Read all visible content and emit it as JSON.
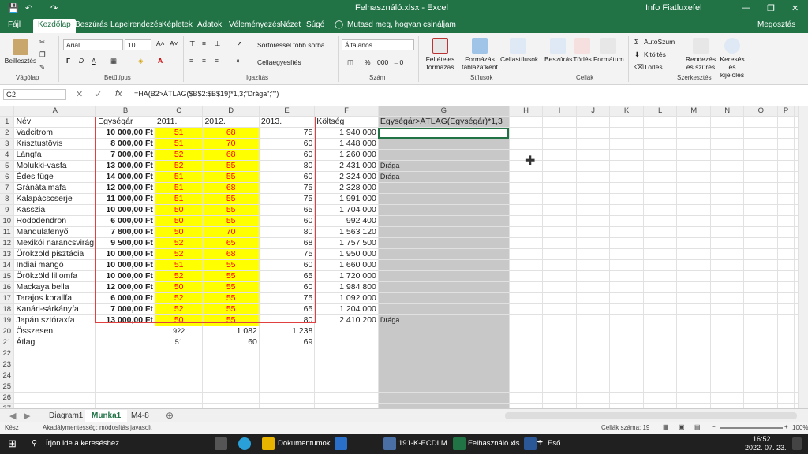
{
  "titlebar": {
    "filename": "Felhasználó.xlsx  -  Excel",
    "user": "Info Fiatluxefel"
  },
  "ribbon_tabs": [
    "Fájl",
    "Kezdőlap",
    "Beszúrás",
    "Lapelrendezés",
    "Képletek",
    "Adatok",
    "Véleményezés",
    "Nézet",
    "Súgó",
    "Mutasd meg, hogyan csináljam"
  ],
  "share": "Megosztás",
  "ribbon": {
    "paste": "Beillesztés",
    "clipboard": "Vágólap",
    "font_name": "Arial",
    "font_size": "10",
    "font_group": "Betűtípus",
    "wrap": "Sortöréssel több sorba",
    "merge": "Cellaegyesítés",
    "align_group": "Igazítás",
    "numfmt": "Általános",
    "number_group": "Szám",
    "cond": "Feltételes formázás",
    "table": "Formázás táblázatként",
    "cellstyles": "Cellastílusok",
    "styles_group": "Stílusok",
    "insert": "Beszúrás",
    "delete": "Törlés",
    "format": "Formátum",
    "cells_group": "Cellák",
    "autosum": "AutoSzum",
    "fill": "Kitöltés",
    "clear": "Törlés",
    "sort": "Rendezés és szűrés",
    "find": "Keresés és kijelölés",
    "edit_group": "Szerkesztés"
  },
  "namebox": "G2",
  "formula": "=HA(B2>ÁTLAG($B$2:$B$19)*1,3;\"Drága\";\"\")",
  "columns": [
    "A",
    "B",
    "C",
    "D",
    "E",
    "F",
    "G",
    "H",
    "I",
    "J",
    "K",
    "L",
    "M",
    "N",
    "O",
    "P"
  ],
  "header_row": [
    "Név",
    "Egységár",
    "2011.",
    "2012.",
    "2013.",
    "Költség",
    "Egységár>ÁTLAG(Egységár)*1,3"
  ],
  "rows": [
    [
      "Vadcitrom",
      "10 000,00 Ft",
      "51",
      "68",
      "75",
      "1 940 000",
      ""
    ],
    [
      "Krisztustövis",
      "8 000,00 Ft",
      "51",
      "70",
      "60",
      "1 448 000",
      ""
    ],
    [
      "Lángfa",
      "7 000,00 Ft",
      "52",
      "68",
      "60",
      "1 260 000",
      ""
    ],
    [
      "Molukki-vasfa",
      "13 000,00 Ft",
      "52",
      "55",
      "80",
      "2 431 000",
      "Drága"
    ],
    [
      "Édes füge",
      "14 000,00 Ft",
      "51",
      "55",
      "60",
      "2 324 000",
      "Drága"
    ],
    [
      "Gránátalmafa",
      "12 000,00 Ft",
      "51",
      "68",
      "75",
      "2 328 000",
      ""
    ],
    [
      "Kalapácscserje",
      "11 000,00 Ft",
      "51",
      "55",
      "75",
      "1 991 000",
      ""
    ],
    [
      "Kasszia",
      "10 000,00 Ft",
      "50",
      "55",
      "65",
      "1 704 000",
      ""
    ],
    [
      "Rododendron",
      "6 000,00 Ft",
      "50",
      "55",
      "60",
      "992 400",
      ""
    ],
    [
      "Mandulafenyő",
      "7 800,00 Ft",
      "50",
      "70",
      "80",
      "1 563 120",
      ""
    ],
    [
      "Mexikói narancsvirág",
      "9 500,00 Ft",
      "52",
      "65",
      "68",
      "1 757 500",
      ""
    ],
    [
      "Örökzöld pisztácia",
      "10 000,00 Ft",
      "52",
      "68",
      "75",
      "1 950 000",
      ""
    ],
    [
      "Indiai mangó",
      "10 000,00 Ft",
      "51",
      "55",
      "60",
      "1 660 000",
      ""
    ],
    [
      "Örökzöld liliomfa",
      "10 000,00 Ft",
      "52",
      "55",
      "65",
      "1 720 000",
      ""
    ],
    [
      "Mackaya bella",
      "12 000,00 Ft",
      "50",
      "55",
      "60",
      "1 984 800",
      ""
    ],
    [
      "Tarajos korallfa",
      "6 000,00 Ft",
      "52",
      "55",
      "75",
      "1 092 000",
      ""
    ],
    [
      "Kanári-sárkányfa",
      "7 000,00 Ft",
      "52",
      "55",
      "65",
      "1 204 000",
      ""
    ],
    [
      "Japán sztóraxfa",
      "13 000,00 Ft",
      "50",
      "55",
      "80",
      "2 410 200",
      "Drága"
    ]
  ],
  "summary": [
    [
      "Összesen",
      "",
      "922",
      "1 082",
      "1 238",
      "",
      ""
    ],
    [
      "Átlag",
      "",
      "51",
      "60",
      "69",
      "",
      ""
    ]
  ],
  "empty_rows": 6,
  "sheets": [
    "Diagram1",
    "Munka1",
    "M4-8"
  ],
  "status": {
    "ready": "Kész",
    "accessibility": "Akadálymentesség: módosítás javasolt",
    "count": "Cellák száma: 19",
    "zoom": "100%"
  },
  "taskbar": {
    "search": "Írjon ide a kereséshez",
    "docs": "Dokumentumok",
    "ecdl": "191-K-ECDLM...",
    "excel": "Felhasználó.xls...",
    "weather": "Eső...",
    "time": "16:52",
    "date": "2022. 07. 23."
  }
}
